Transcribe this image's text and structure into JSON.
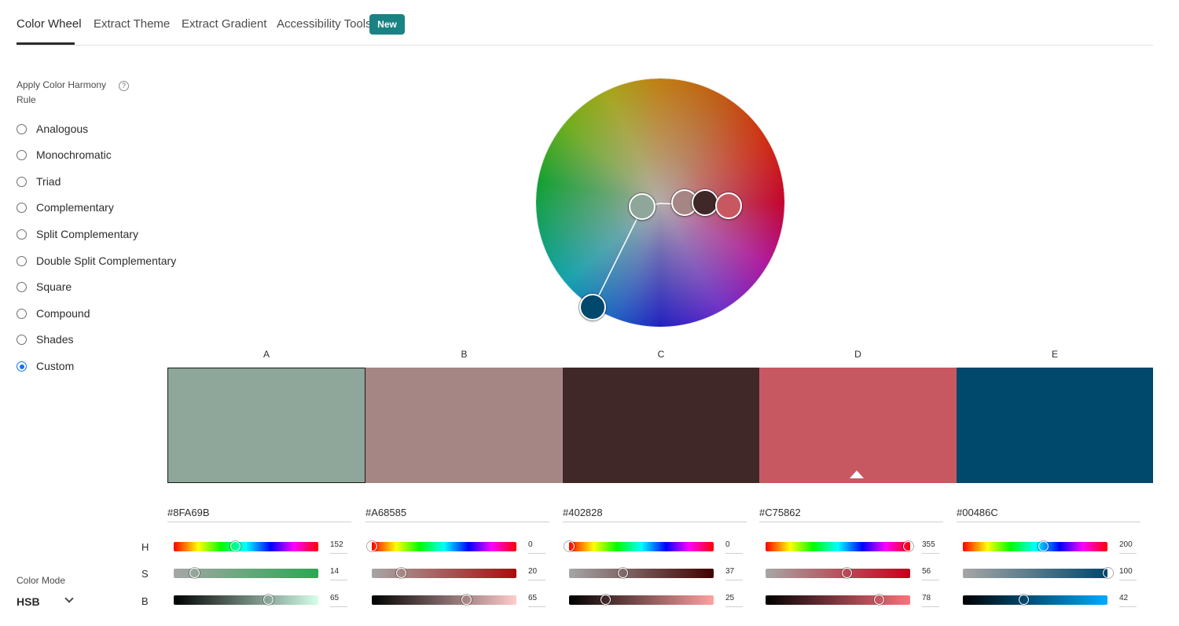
{
  "tabs": [
    {
      "label": "Color Wheel",
      "active": true
    },
    {
      "label": "Extract Theme",
      "active": false
    },
    {
      "label": "Extract Gradient",
      "active": false
    },
    {
      "label": "Accessibility Tools",
      "active": false
    }
  ],
  "new_badge": "New",
  "harmony": {
    "heading": "Apply Color Harmony Rule",
    "help_glyph": "?",
    "rules": [
      "Analogous",
      "Monochromatic",
      "Triad",
      "Complementary",
      "Split Complementary",
      "Double Split Complementary",
      "Square",
      "Compound",
      "Shades",
      "Custom"
    ],
    "selected": "Custom"
  },
  "color_mode": {
    "label": "Color Mode",
    "value": "HSB"
  },
  "axis_labels": [
    "H",
    "S",
    "B"
  ],
  "swatches": [
    {
      "letter": "A",
      "hex": "#8FA69B",
      "color": "#8FA69B",
      "h": 152,
      "s": 14,
      "b": 65,
      "selected": true,
      "s_color": "#29a853",
      "b_color": "#d6ffeb"
    },
    {
      "letter": "B",
      "hex": "#A68585",
      "color": "#A68585",
      "h": 0,
      "s": 20,
      "b": 65,
      "selected": false,
      "s_color": "#a80d0d",
      "b_color": "#ffcccc"
    },
    {
      "letter": "C",
      "hex": "#402828",
      "color": "#402828",
      "h": 0,
      "s": 37,
      "b": 25,
      "selected": false,
      "s_color": "#400000",
      "b_color": "#ffa1a1"
    },
    {
      "letter": "D",
      "hex": "#C75862",
      "color": "#C75862",
      "h": 355,
      "s": 56,
      "b": 78,
      "selected": false,
      "base": true,
      "s_color": "#c7001a",
      "b_color": "#ff707d"
    },
    {
      "letter": "E",
      "hex": "#00486C",
      "color": "#00486C",
      "h": 200,
      "s": 100,
      "b": 42,
      "selected": false,
      "s_color": "#00486c",
      "b_color": "#00aaff"
    }
  ]
}
